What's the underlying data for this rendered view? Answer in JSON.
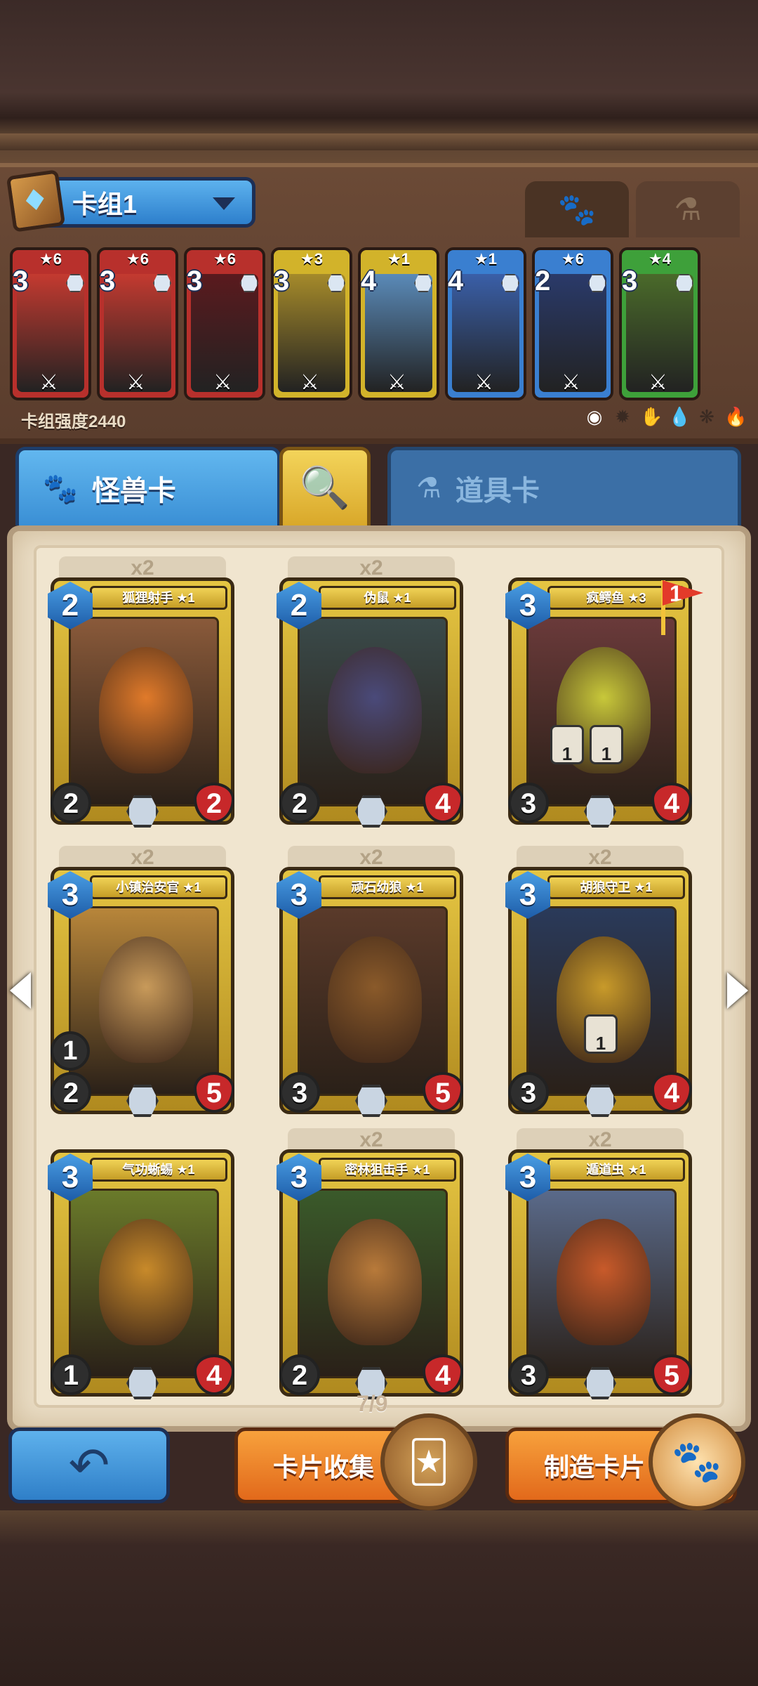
{
  "deck": {
    "name": "卡组1",
    "power_text": "卡组强度2440",
    "slots": [
      {
        "rarity": "★6",
        "cost": "3",
        "color": "#b8302c",
        "art": "#c43a30"
      },
      {
        "rarity": "★6",
        "cost": "3",
        "color": "#b8302c",
        "art": "#c43a30"
      },
      {
        "rarity": "★6",
        "cost": "3",
        "color": "#b8302c",
        "art": "#5a1a1e"
      },
      {
        "rarity": "★3",
        "cost": "3",
        "color": "#d2b32a",
        "art": "#a58a2a"
      },
      {
        "rarity": "★1",
        "cost": "4",
        "color": "#d2b32a",
        "art": "#5a8ab8"
      },
      {
        "rarity": "★1",
        "cost": "4",
        "color": "#3a7fd0",
        "art": "#3a5fa8"
      },
      {
        "rarity": "★6",
        "cost": "2",
        "color": "#3a7fd0",
        "art": "#2a3a6a"
      },
      {
        "rarity": "★4",
        "cost": "3",
        "color": "#3ea03a",
        "art": "#4a6a2a"
      }
    ]
  },
  "tabs": {
    "monster_label": "怪兽卡",
    "item_label": "道具卡"
  },
  "cards": [
    {
      "name": "狐狸射手 ★1",
      "cost": "2",
      "atk": "2",
      "hp": "2",
      "count": "x2",
      "art": "#8a5a3a",
      "creature": "#e07a2a"
    },
    {
      "name": "伪鼠 ★1",
      "cost": "2",
      "atk": "2",
      "hp": "4",
      "count": "x2",
      "art": "#3a4a4a",
      "creature": "#4a4a7a"
    },
    {
      "name": "疯鳄鱼 ★3",
      "cost": "3",
      "atk": "3",
      "hp": "4",
      "count": "",
      "art": "#6a3a3a",
      "creature": "#c8c83a",
      "flag": "1",
      "badge1": "1",
      "badge2": "1"
    },
    {
      "name": "小镇治安官 ★1",
      "cost": "3",
      "atk": "2",
      "hp": "5",
      "count": "x2",
      "art": "#b8863a",
      "creature": "#c89a5a",
      "extra": "1"
    },
    {
      "name": "顽石幼狼 ★1",
      "cost": "3",
      "atk": "3",
      "hp": "5",
      "count": "x2",
      "art": "#5a3a2a",
      "creature": "#8a5a2a"
    },
    {
      "name": "胡狼守卫 ★1",
      "cost": "3",
      "atk": "3",
      "hp": "4",
      "count": "x2",
      "art": "#2a3a5a",
      "creature": "#c89a2a",
      "badge1": "1"
    },
    {
      "name": "气功蜥蜴 ★1",
      "cost": "3",
      "atk": "1",
      "hp": "4",
      "count": "",
      "art": "#6a7a2a",
      "creature": "#c88a2a"
    },
    {
      "name": "密林狙击手 ★1",
      "cost": "3",
      "atk": "2",
      "hp": "4",
      "count": "x2",
      "art": "#3a5a2a",
      "creature": "#b87a3a"
    },
    {
      "name": "遁道虫 ★1",
      "cost": "3",
      "atk": "3",
      "hp": "5",
      "count": "x2",
      "art": "#5a6a8a",
      "creature": "#c85a2a"
    }
  ],
  "page_indicator": "7/9",
  "buttons": {
    "collect_label": "卡片收集",
    "craft_label": "制造卡片"
  }
}
